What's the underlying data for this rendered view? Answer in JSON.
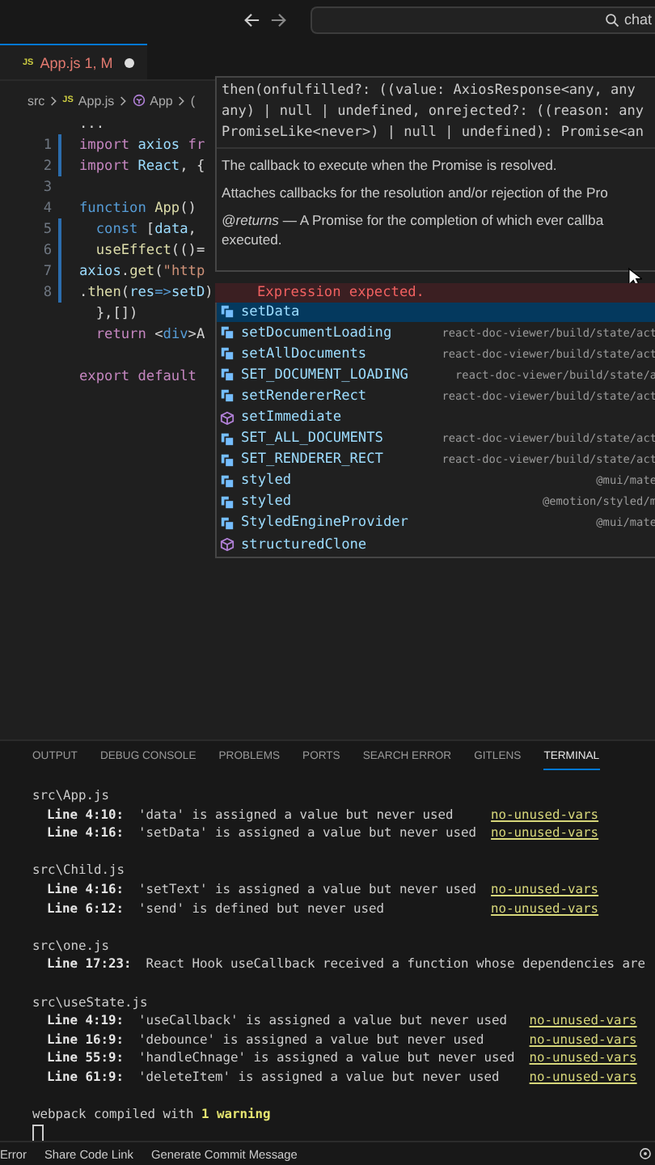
{
  "title_bar": {
    "search": {
      "value": "chat"
    }
  },
  "editor_tabs": [
    {
      "file_badge": "JS",
      "label": "App.js 1, M",
      "selected": true,
      "modified": true
    }
  ],
  "breadcrumb": {
    "badge": "JS",
    "items": [
      "src",
      "App.js",
      "App",
      "("
    ]
  },
  "code_lines": [
    {
      "modified": false,
      "segments": [
        {
          "text": "...",
          "kind": "plain"
        }
      ]
    },
    {
      "number": "1",
      "modified": true,
      "segments": [
        {
          "text": "import ",
          "kind": "control"
        },
        {
          "text": "axios ",
          "kind": "var"
        },
        {
          "text": "fr",
          "kind": "control"
        }
      ]
    },
    {
      "number": "2",
      "modified": true,
      "segments": [
        {
          "text": "import ",
          "kind": "control"
        },
        {
          "text": "React",
          "kind": "var"
        },
        {
          "text": ", {",
          "kind": "plain"
        }
      ]
    },
    {
      "number": "3",
      "modified": false
    },
    {
      "number": "4",
      "modified": false,
      "segments": [
        {
          "text": "function ",
          "kind": "keyword"
        },
        {
          "text": "App",
          "kind": "fn"
        },
        {
          "text": "()",
          "kind": "plain"
        }
      ]
    },
    {
      "number": "5",
      "modified": true,
      "segments": [
        {
          "text": "  const ",
          "kind": "keyword"
        },
        {
          "text": "[",
          "kind": "plain"
        },
        {
          "text": "data",
          "kind": "var"
        },
        {
          "text": ",",
          "kind": "plain"
        }
      ]
    },
    {
      "number": "6",
      "modified": true,
      "segments": [
        {
          "text": "  useEffect",
          "kind": "fn"
        },
        {
          "text": "(()=",
          "kind": "plain"
        }
      ]
    },
    {
      "number": "7",
      "modified": true,
      "segments": [
        {
          "text": "axios",
          "kind": "var"
        },
        {
          "text": ".",
          "kind": "plain"
        },
        {
          "text": "get",
          "kind": "fn"
        },
        {
          "text": "(",
          "kind": "plain"
        },
        {
          "text": "\"http",
          "kind": "string"
        }
      ]
    },
    {
      "number": "8",
      "modified": true,
      "error": "Expression expected.",
      "segments": [
        {
          "text": ".",
          "kind": "plain"
        },
        {
          "text": "then",
          "kind": "fn"
        },
        {
          "text": "(",
          "kind": "plain"
        },
        {
          "text": "res",
          "kind": "var"
        },
        {
          "text": "=>",
          "kind": "keyword"
        },
        {
          "text": "setD",
          "kind": "var"
        },
        {
          "text": ")",
          "kind": "plain"
        }
      ]
    },
    {
      "modified": false,
      "segments": [
        {
          "text": "  },[])",
          "kind": "plain"
        }
      ]
    },
    {
      "modified": false,
      "segments": [
        {
          "text": "  return ",
          "kind": "control"
        },
        {
          "text": "<",
          "kind": "plain"
        },
        {
          "text": "div",
          "kind": "keyword"
        },
        {
          "text": ">A",
          "kind": "plain"
        }
      ]
    },
    {
      "modified": false
    },
    {
      "modified": false,
      "segments": [
        {
          "text": "export default",
          "kind": "control"
        }
      ]
    }
  ],
  "hover_popup": {
    "signature": [
      "then(onfulfilled?: ((value: AxiosResponse<any, any",
      "any) | null | undefined, onrejected?: ((reason: any",
      "PromiseLike<never>) | null | undefined): Promise<an"
    ],
    "summary": "The callback to execute when the Promise is resolved.",
    "description": "Attaches callbacks for the resolution and/or rejection of the Pro",
    "returns": "*@returns* — A Promise for the completion of which ever callba",
    "returns_continued": "executed."
  },
  "suggestions": [
    {
      "label": "setData",
      "kind": "variable",
      "selected": true
    },
    {
      "label": "setDocumentLoading",
      "detail": "react-doc-viewer/build/state/act",
      "kind": "variable",
      "selected": false
    },
    {
      "label": "setAllDocuments",
      "detail": "react-doc-viewer/build/state/act",
      "kind": "variable",
      "selected": false
    },
    {
      "label": "SET_DOCUMENT_LOADING",
      "detail": "react-doc-viewer/build/state/a",
      "kind": "variable",
      "selected": false
    },
    {
      "label": "setRendererRect",
      "detail": "react-doc-viewer/build/state/act",
      "kind": "variable",
      "selected": false
    },
    {
      "label": "setImmediate",
      "kind": "module",
      "selected": false
    },
    {
      "label": "SET_ALL_DOCUMENTS",
      "detail": "react-doc-viewer/build/state/act",
      "kind": "variable",
      "selected": false
    },
    {
      "label": "SET_RENDERER_RECT",
      "detail": "react-doc-viewer/build/state/act",
      "kind": "variable",
      "selected": false
    },
    {
      "label": "styled",
      "detail": "@mui/mate",
      "kind": "variable",
      "selected": false
    },
    {
      "label": "styled",
      "detail": "@emotion/styled/m",
      "kind": "variable",
      "selected": false
    },
    {
      "label": "StyledEngineProvider",
      "detail": "@mui/mate",
      "kind": "variable",
      "selected": false
    },
    {
      "label": "structuredClone",
      "kind": "module",
      "selected": false
    }
  ],
  "panel_tabs": [
    {
      "label": "OUTPUT",
      "selected": false
    },
    {
      "label": "DEBUG CONSOLE",
      "selected": false
    },
    {
      "label": "PROBLEMS",
      "selected": false
    },
    {
      "label": "PORTS",
      "selected": false
    },
    {
      "label": "SEARCH ERROR",
      "selected": false
    },
    {
      "label": "GITLENS",
      "selected": false
    },
    {
      "label": "TERMINAL",
      "selected": true
    }
  ],
  "terminal": {
    "groups": [
      {
        "file": "src\\App.js",
        "warnings": [
          {
            "location": "Line 4:10:",
            "message": "'data' is assigned a value but never used",
            "rule": "no-unused-vars"
          },
          {
            "location": "Line 4:16:",
            "message": "'setData' is assigned a value but never used",
            "rule": "no-unused-vars"
          }
        ]
      },
      {
        "file": "src\\Child.js",
        "warnings": [
          {
            "location": "Line 4:16:",
            "message": "'setText' is assigned a value but never used",
            "rule": "no-unused-vars"
          },
          {
            "location": "Line 6:12:",
            "message": "'send' is defined but never used",
            "rule": "no-unused-vars"
          }
        ]
      },
      {
        "file": "src\\one.js",
        "warnings": [
          {
            "location": "Line 17:23:",
            "message": "React Hook useCallback received a function whose dependencies are"
          }
        ]
      },
      {
        "file": "src\\useState.js",
        "warnings": [
          {
            "location": "Line 4:19:",
            "message": "'useCallback' is assigned a value but never used",
            "rule": "no-unused-vars"
          },
          {
            "location": "Line 16:9:",
            "message": "'debounce' is assigned a value but never used",
            "rule": "no-unused-vars"
          },
          {
            "location": "Line 55:9:",
            "message": "'handleChnage' is assigned a value but never used",
            "rule": "no-unused-vars"
          },
          {
            "location": "Line 61:9:",
            "message": "'deleteItem' is assigned a value but never used",
            "rule": "no-unused-vars"
          }
        ]
      }
    ],
    "summary": "webpack compiled with **1 warning**"
  },
  "status_bar": [
    "Error",
    "Share Code Link",
    "Generate Commit Message"
  ]
}
